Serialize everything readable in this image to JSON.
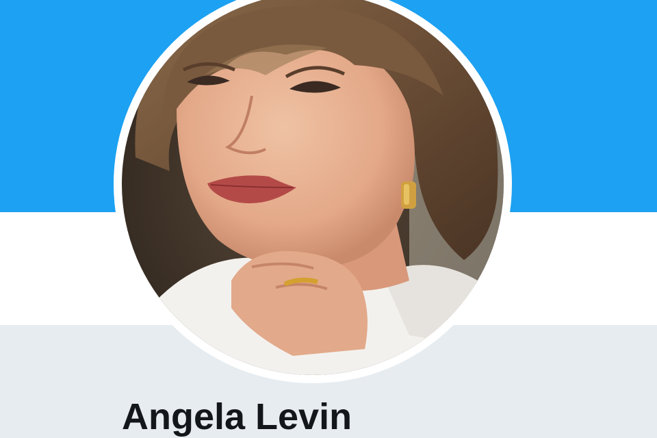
{
  "profile": {
    "display_name": "Angela Levin"
  },
  "colors": {
    "banner": "#1da1f2",
    "nav_background": "#ffffff",
    "page_background": "#e6ecf0",
    "name_text": "#14171a"
  },
  "icons": {
    "avatar": "profile-photo"
  }
}
